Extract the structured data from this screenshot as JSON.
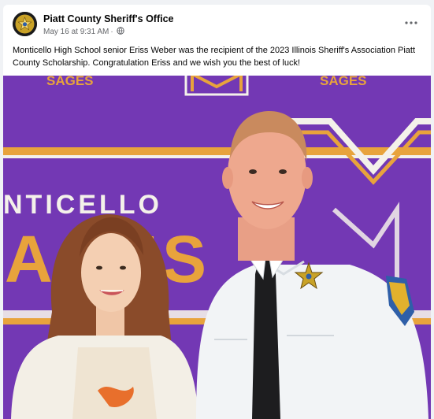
{
  "post": {
    "page_name": "Piatt County Sheriff's Office",
    "avatar_text": "SHERIFF",
    "timestamp": "May 16 at 9:31 AM",
    "separator": "·",
    "audience_icon": "globe-icon",
    "more_icon": "more-options-icon",
    "caption": "Monticello High School senior Eriss Weber was the recipient of the 2023 Illinois Sheriff's Association Piatt County Scholarship.  Congratulation Eriss and we wish you the best of luck!"
  },
  "photo": {
    "backdrop_text": {
      "top_left": "SAGES",
      "top_right": "SAGES",
      "school": "NTICELLO",
      "team": "AGES"
    },
    "colors": {
      "purple": "#7b3dbd",
      "gold": "#e8a33c",
      "white": "#f4f1ea"
    }
  }
}
